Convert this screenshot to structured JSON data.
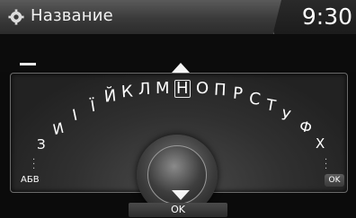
{
  "header": {
    "title": "Название",
    "clock": "9:30",
    "icon": "gear-icon"
  },
  "input": {
    "value": "",
    "cursor": "_"
  },
  "keyboard": {
    "letters": [
      "З",
      "И",
      "І",
      "Ї",
      "Й",
      "К",
      "Л",
      "М",
      "Н",
      "О",
      "П",
      "Р",
      "С",
      "Т",
      "У",
      "Ф",
      "Х"
    ],
    "selected_letter": "Н",
    "left_label": "АБВ",
    "right_ok_label": "OK"
  },
  "bottom": {
    "ok_label": "OK"
  },
  "colors": {
    "header_bg": "#4a4a4a",
    "panel_bg": "#2e2e2e",
    "text": "#ffffff"
  }
}
